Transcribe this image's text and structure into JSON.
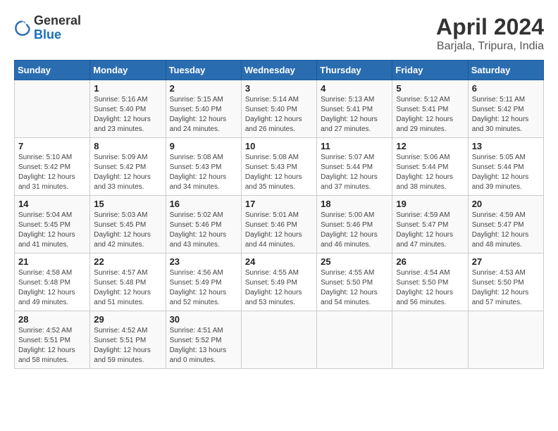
{
  "header": {
    "logo_general": "General",
    "logo_blue": "Blue",
    "title": "April 2024",
    "subtitle": "Barjala, Tripura, India"
  },
  "days_of_week": [
    "Sunday",
    "Monday",
    "Tuesday",
    "Wednesday",
    "Thursday",
    "Friday",
    "Saturday"
  ],
  "weeks": [
    [
      {
        "day": "",
        "sunrise": "",
        "sunset": "",
        "daylight": ""
      },
      {
        "day": "1",
        "sunrise": "Sunrise: 5:16 AM",
        "sunset": "Sunset: 5:40 PM",
        "daylight": "Daylight: 12 hours and 23 minutes."
      },
      {
        "day": "2",
        "sunrise": "Sunrise: 5:15 AM",
        "sunset": "Sunset: 5:40 PM",
        "daylight": "Daylight: 12 hours and 24 minutes."
      },
      {
        "day": "3",
        "sunrise": "Sunrise: 5:14 AM",
        "sunset": "Sunset: 5:40 PM",
        "daylight": "Daylight: 12 hours and 26 minutes."
      },
      {
        "day": "4",
        "sunrise": "Sunrise: 5:13 AM",
        "sunset": "Sunset: 5:41 PM",
        "daylight": "Daylight: 12 hours and 27 minutes."
      },
      {
        "day": "5",
        "sunrise": "Sunrise: 5:12 AM",
        "sunset": "Sunset: 5:41 PM",
        "daylight": "Daylight: 12 hours and 29 minutes."
      },
      {
        "day": "6",
        "sunrise": "Sunrise: 5:11 AM",
        "sunset": "Sunset: 5:42 PM",
        "daylight": "Daylight: 12 hours and 30 minutes."
      }
    ],
    [
      {
        "day": "7",
        "sunrise": "Sunrise: 5:10 AM",
        "sunset": "Sunset: 5:42 PM",
        "daylight": "Daylight: 12 hours and 31 minutes."
      },
      {
        "day": "8",
        "sunrise": "Sunrise: 5:09 AM",
        "sunset": "Sunset: 5:42 PM",
        "daylight": "Daylight: 12 hours and 33 minutes."
      },
      {
        "day": "9",
        "sunrise": "Sunrise: 5:08 AM",
        "sunset": "Sunset: 5:43 PM",
        "daylight": "Daylight: 12 hours and 34 minutes."
      },
      {
        "day": "10",
        "sunrise": "Sunrise: 5:08 AM",
        "sunset": "Sunset: 5:43 PM",
        "daylight": "Daylight: 12 hours and 35 minutes."
      },
      {
        "day": "11",
        "sunrise": "Sunrise: 5:07 AM",
        "sunset": "Sunset: 5:44 PM",
        "daylight": "Daylight: 12 hours and 37 minutes."
      },
      {
        "day": "12",
        "sunrise": "Sunrise: 5:06 AM",
        "sunset": "Sunset: 5:44 PM",
        "daylight": "Daylight: 12 hours and 38 minutes."
      },
      {
        "day": "13",
        "sunrise": "Sunrise: 5:05 AM",
        "sunset": "Sunset: 5:44 PM",
        "daylight": "Daylight: 12 hours and 39 minutes."
      }
    ],
    [
      {
        "day": "14",
        "sunrise": "Sunrise: 5:04 AM",
        "sunset": "Sunset: 5:45 PM",
        "daylight": "Daylight: 12 hours and 41 minutes."
      },
      {
        "day": "15",
        "sunrise": "Sunrise: 5:03 AM",
        "sunset": "Sunset: 5:45 PM",
        "daylight": "Daylight: 12 hours and 42 minutes."
      },
      {
        "day": "16",
        "sunrise": "Sunrise: 5:02 AM",
        "sunset": "Sunset: 5:46 PM",
        "daylight": "Daylight: 12 hours and 43 minutes."
      },
      {
        "day": "17",
        "sunrise": "Sunrise: 5:01 AM",
        "sunset": "Sunset: 5:46 PM",
        "daylight": "Daylight: 12 hours and 44 minutes."
      },
      {
        "day": "18",
        "sunrise": "Sunrise: 5:00 AM",
        "sunset": "Sunset: 5:46 PM",
        "daylight": "Daylight: 12 hours and 46 minutes."
      },
      {
        "day": "19",
        "sunrise": "Sunrise: 4:59 AM",
        "sunset": "Sunset: 5:47 PM",
        "daylight": "Daylight: 12 hours and 47 minutes."
      },
      {
        "day": "20",
        "sunrise": "Sunrise: 4:59 AM",
        "sunset": "Sunset: 5:47 PM",
        "daylight": "Daylight: 12 hours and 48 minutes."
      }
    ],
    [
      {
        "day": "21",
        "sunrise": "Sunrise: 4:58 AM",
        "sunset": "Sunset: 5:48 PM",
        "daylight": "Daylight: 12 hours and 49 minutes."
      },
      {
        "day": "22",
        "sunrise": "Sunrise: 4:57 AM",
        "sunset": "Sunset: 5:48 PM",
        "daylight": "Daylight: 12 hours and 51 minutes."
      },
      {
        "day": "23",
        "sunrise": "Sunrise: 4:56 AM",
        "sunset": "Sunset: 5:49 PM",
        "daylight": "Daylight: 12 hours and 52 minutes."
      },
      {
        "day": "24",
        "sunrise": "Sunrise: 4:55 AM",
        "sunset": "Sunset: 5:49 PM",
        "daylight": "Daylight: 12 hours and 53 minutes."
      },
      {
        "day": "25",
        "sunrise": "Sunrise: 4:55 AM",
        "sunset": "Sunset: 5:50 PM",
        "daylight": "Daylight: 12 hours and 54 minutes."
      },
      {
        "day": "26",
        "sunrise": "Sunrise: 4:54 AM",
        "sunset": "Sunset: 5:50 PM",
        "daylight": "Daylight: 12 hours and 56 minutes."
      },
      {
        "day": "27",
        "sunrise": "Sunrise: 4:53 AM",
        "sunset": "Sunset: 5:50 PM",
        "daylight": "Daylight: 12 hours and 57 minutes."
      }
    ],
    [
      {
        "day": "28",
        "sunrise": "Sunrise: 4:52 AM",
        "sunset": "Sunset: 5:51 PM",
        "daylight": "Daylight: 12 hours and 58 minutes."
      },
      {
        "day": "29",
        "sunrise": "Sunrise: 4:52 AM",
        "sunset": "Sunset: 5:51 PM",
        "daylight": "Daylight: 12 hours and 59 minutes."
      },
      {
        "day": "30",
        "sunrise": "Sunrise: 4:51 AM",
        "sunset": "Sunset: 5:52 PM",
        "daylight": "Daylight: 13 hours and 0 minutes."
      },
      {
        "day": "",
        "sunrise": "",
        "sunset": "",
        "daylight": ""
      },
      {
        "day": "",
        "sunrise": "",
        "sunset": "",
        "daylight": ""
      },
      {
        "day": "",
        "sunrise": "",
        "sunset": "",
        "daylight": ""
      },
      {
        "day": "",
        "sunrise": "",
        "sunset": "",
        "daylight": ""
      }
    ]
  ]
}
